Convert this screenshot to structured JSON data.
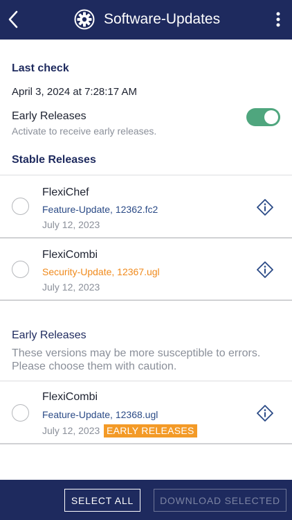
{
  "header": {
    "title": "Software-Updates",
    "back_icon": "chevron-left-icon",
    "title_icon": "gear-icon",
    "menu_icon": "vertical-dots-icon"
  },
  "last_check": {
    "heading": "Last check",
    "value": "April 3, 2024 at 7:28:17 AM"
  },
  "early_toggle": {
    "label": "Early Releases",
    "hint": "Activate to receive early releases.",
    "enabled": true
  },
  "stable": {
    "heading": "Stable Releases",
    "items": [
      {
        "name": "FlexiChef",
        "version": "Feature-Update, 12362.fc2",
        "date": "July 12, 2023",
        "version_color": "#2a4a86"
      },
      {
        "name": "FlexiCombi",
        "version": "Security-Update, 12367.ugl",
        "date": "July 12, 2023",
        "version_color": "#f08a1c"
      }
    ]
  },
  "early": {
    "heading": "Early Releases",
    "note_line1": "These versions may be more susceptible to errors.",
    "note_line2": "Please choose them with caution.",
    "items": [
      {
        "name": "FlexiCombi",
        "version": "Feature-Update, 12368.ugl",
        "date": "July 12, 2023",
        "badge": "EARLY RELEASES",
        "version_color": "#2a4a86"
      }
    ]
  },
  "footer": {
    "select_all": "SELECT ALL",
    "download_selected": "DOWNLOAD SELECTED"
  },
  "colors": {
    "bar": "#1e2a5e",
    "toggle_on": "#4fa67e",
    "badge": "#f39a27"
  }
}
